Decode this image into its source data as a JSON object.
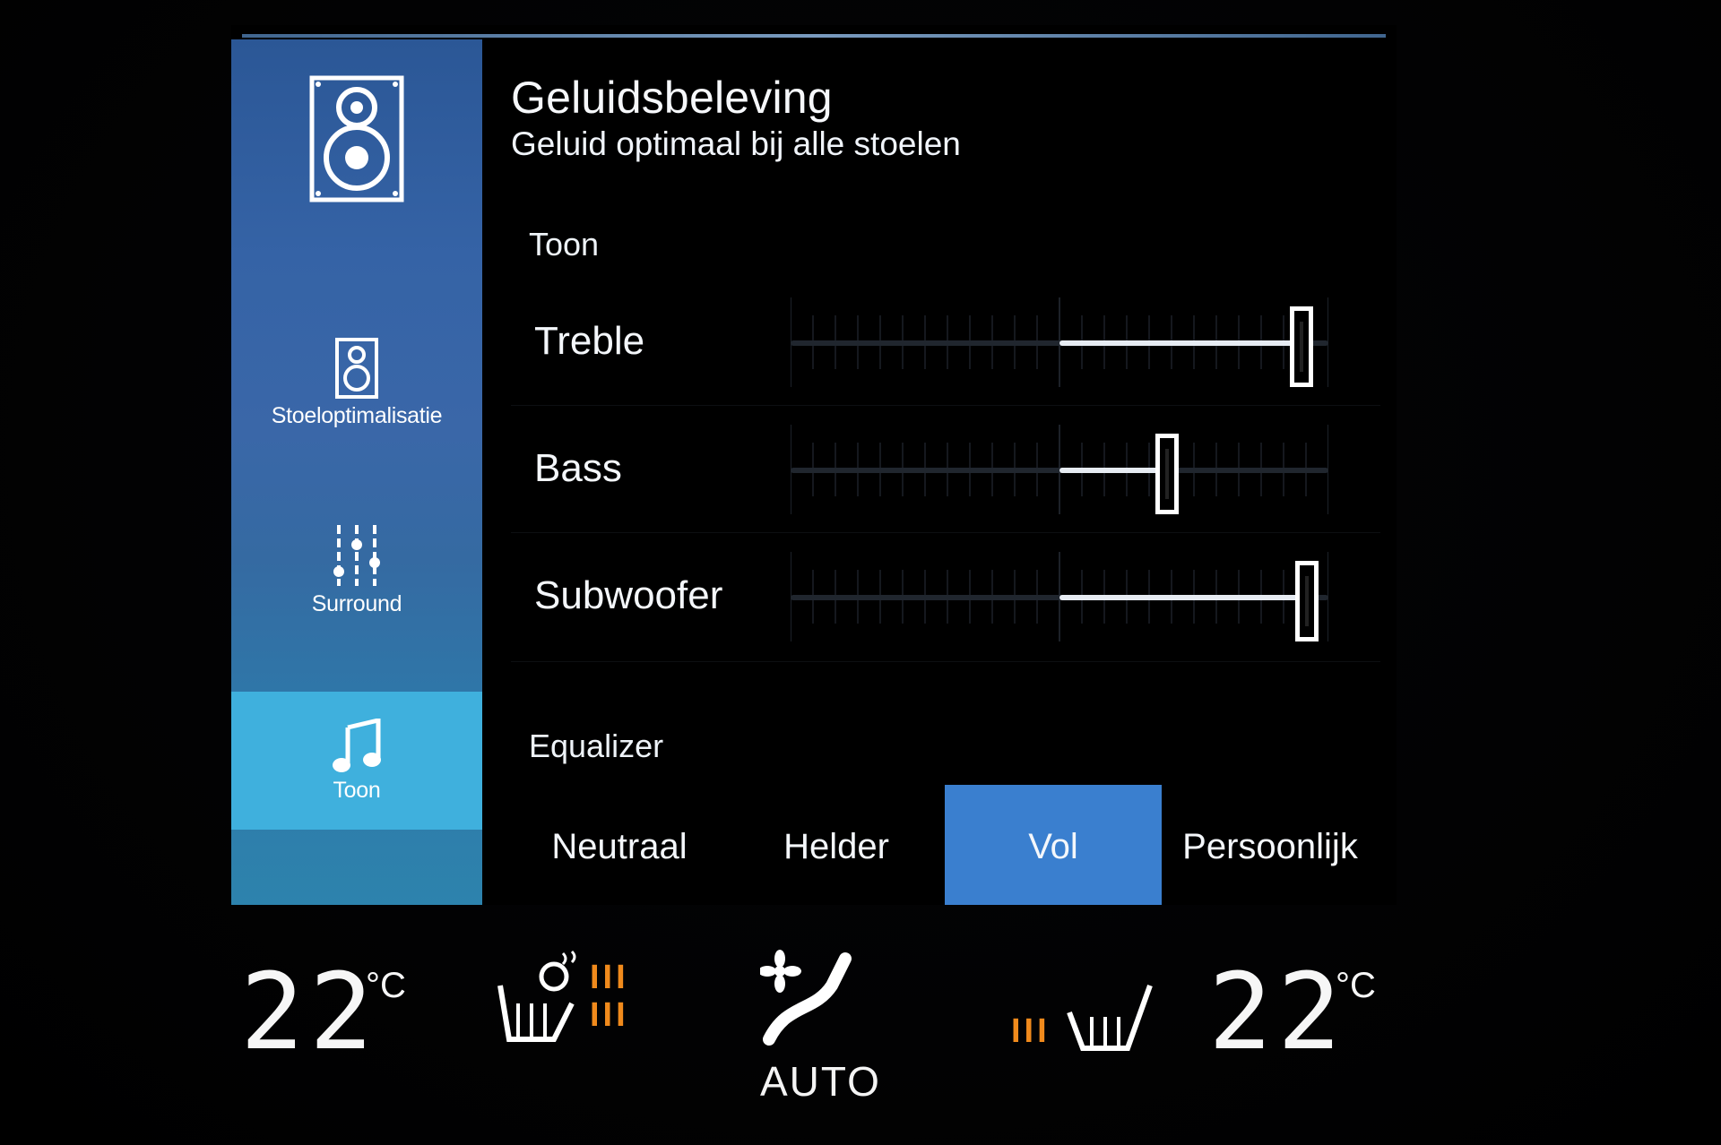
{
  "header": {
    "title": "Geluidsbeleving",
    "subtitle": "Geluid optimaal bij alle stoelen"
  },
  "sidebar": {
    "items": [
      {
        "label": "",
        "icon": "speaker-icon"
      },
      {
        "label": "Stoeloptimalisatie",
        "icon": "speaker-small-icon"
      },
      {
        "label": "Surround",
        "icon": "mixer-sliders-icon"
      },
      {
        "label": "Toon",
        "icon": "music-note-icon",
        "active": true
      }
    ]
  },
  "tone": {
    "section_label": "Toon",
    "sliders": [
      {
        "label": "Treble",
        "level": 0.95
      },
      {
        "label": "Bass",
        "level": 0.7
      },
      {
        "label": "Subwoofer",
        "level": 0.96
      }
    ]
  },
  "equalizer": {
    "section_label": "Equalizer",
    "options": [
      "Neutraal",
      "Helder",
      "Vol",
      "Persoonlijk"
    ],
    "selected": "Vol"
  },
  "climate": {
    "left_temp": "22",
    "left_unit": "°C",
    "right_temp": "22",
    "right_unit": "°C",
    "left_seat_heat": "III",
    "left_seat_heat_2": "III",
    "right_seat_heat": "III",
    "fan_mode": "AUTO"
  },
  "colors": {
    "accent": "#3a7fcf",
    "sidebar_active": "#3fb0dd",
    "heat": "#f08a1c"
  }
}
